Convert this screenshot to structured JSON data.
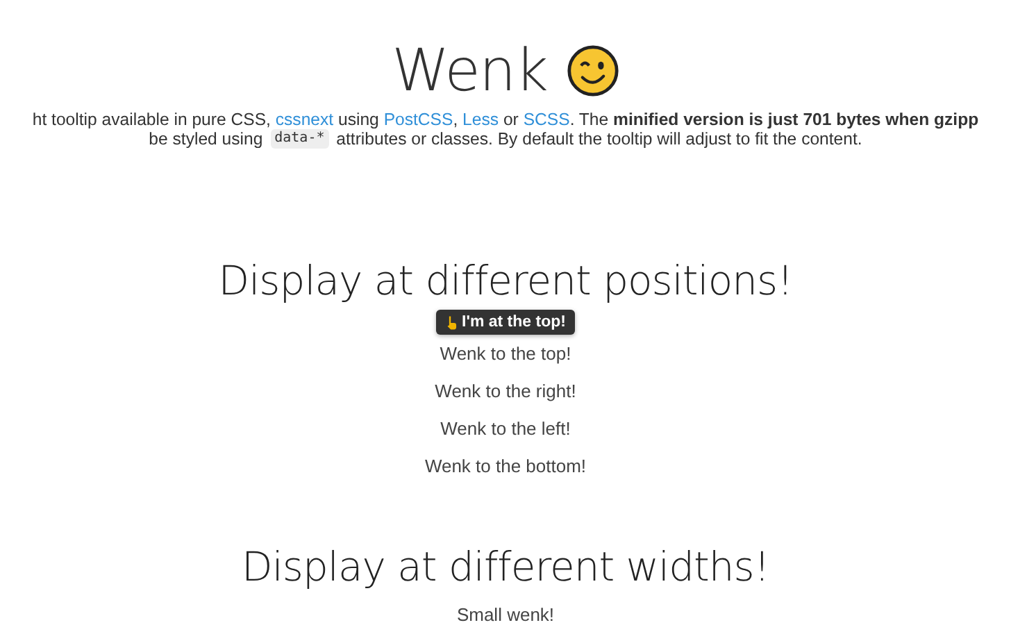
{
  "title": "Wenk",
  "intro": [
    [
      {
        "kind": "text",
        "text": "ht tooltip available in pure CSS, "
      },
      {
        "kind": "link",
        "text": "cssnext"
      },
      {
        "kind": "text",
        "text": " using "
      },
      {
        "kind": "link",
        "text": "PostCSS"
      },
      {
        "kind": "text",
        "text": ", "
      },
      {
        "kind": "link",
        "text": "Less"
      },
      {
        "kind": "text",
        "text": " or "
      },
      {
        "kind": "link",
        "text": "SCSS"
      },
      {
        "kind": "text",
        "text": ". The "
      },
      {
        "kind": "bold",
        "text": "minified version is just 701 bytes when gzipp"
      }
    ],
    [
      {
        "kind": "text",
        "text": "be styled using "
      },
      {
        "kind": "code",
        "text": "data-*"
      },
      {
        "kind": "text",
        "text": " attributes or classes. By default the tooltip will adjust to fit the content."
      }
    ]
  ],
  "sections": [
    {
      "heading": "Display at different positions!",
      "items": [
        {
          "label": "Wenk to the top!",
          "tooltip": "I'm at the top!"
        },
        {
          "label": "Wenk to the right!"
        },
        {
          "label": "Wenk to the left!"
        },
        {
          "label": "Wenk to the bottom!"
        }
      ]
    },
    {
      "heading": "Display at different widths!",
      "items": [
        {
          "label": "Small wenk!"
        }
      ]
    }
  ]
}
